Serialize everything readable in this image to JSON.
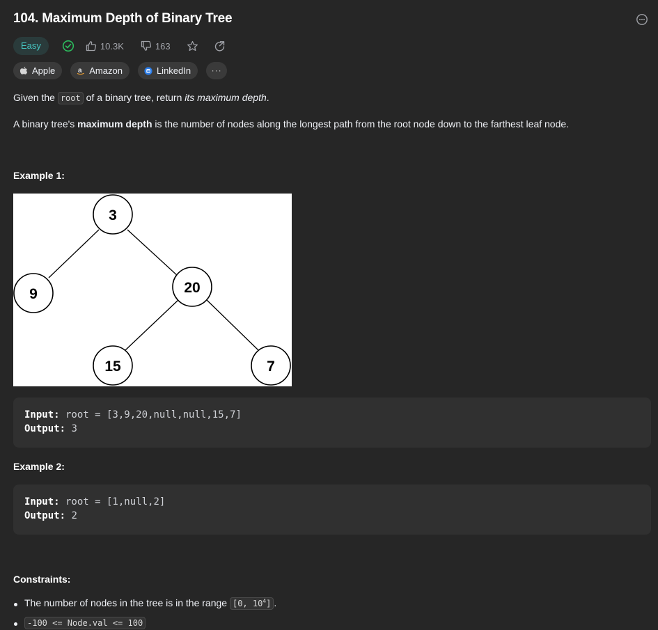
{
  "problem": {
    "title": "104. Maximum Depth of Binary Tree",
    "difficulty": "Easy",
    "likes": "10.3K",
    "dislikes": "163"
  },
  "tags": [
    {
      "label": "Apple",
      "icon": "apple-icon"
    },
    {
      "label": "Amazon",
      "icon": "amazon-icon"
    },
    {
      "label": "LinkedIn",
      "icon": "linkedin-icon"
    }
  ],
  "more_tags_label": "···",
  "description": {
    "p1_before": "Given the ",
    "p1_code": "root",
    "p1_mid": " of a binary tree, return ",
    "p1_em": "its maximum depth",
    "p1_after": ".",
    "p2_before": "A binary tree's ",
    "p2_strong": "maximum depth",
    "p2_after": " is the number of nodes along the longest path from the root node down to the farthest leaf node."
  },
  "example1": {
    "heading": "Example 1:",
    "tree_nodes": [
      "3",
      "9",
      "20",
      "15",
      "7"
    ],
    "input_label": "Input:",
    "input_value": " root = [3,9,20,null,null,15,7]",
    "output_label": "Output:",
    "output_value": " 3"
  },
  "example2": {
    "heading": "Example 2:",
    "input_label": "Input:",
    "input_value": " root = [1,null,2]",
    "output_label": "Output:",
    "output_value": " 2"
  },
  "constraints": {
    "heading": "Constraints:",
    "c1_before": "The number of nodes in the tree is in the range ",
    "c1_code_start": "[0, 10",
    "c1_code_sup": "4",
    "c1_code_end": "]",
    "c1_after": ".",
    "c2_code": "-100 <= Node.val <= 100"
  },
  "colors": {
    "background": "#262626",
    "easy": "#46c6c2",
    "solved": "#2cbb5d",
    "code_block": "#303030"
  }
}
